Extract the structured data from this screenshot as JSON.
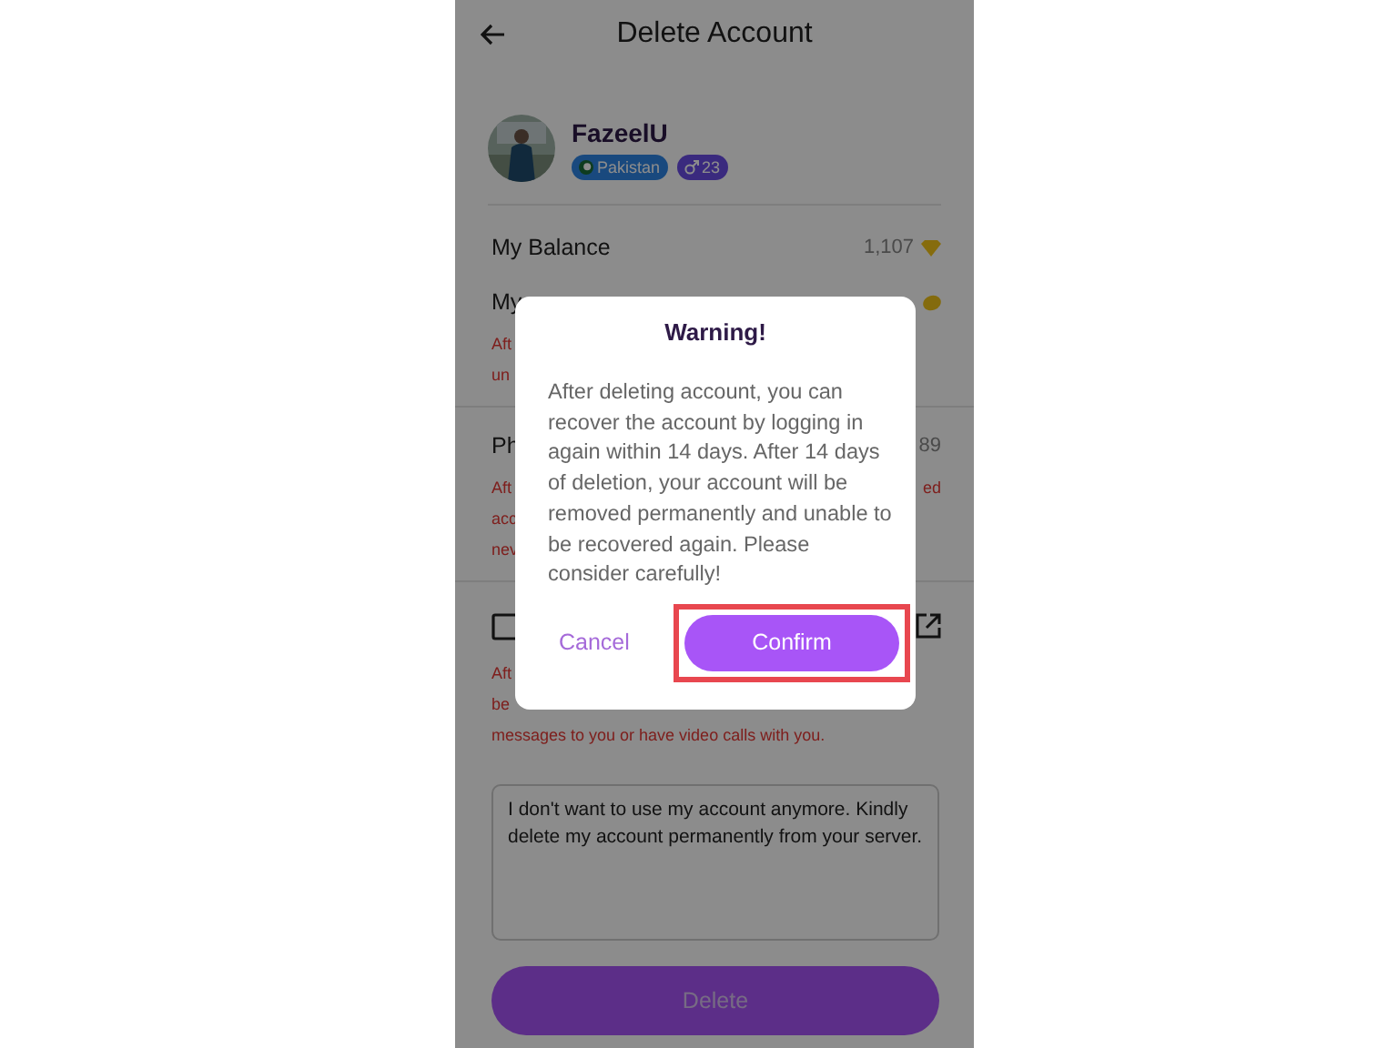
{
  "header": {
    "title": "Delete Account"
  },
  "profile": {
    "name": "FazeelU",
    "country": "Pakistan",
    "age": "23"
  },
  "rows": [
    {
      "kind": "balance",
      "label": "My Balance",
      "value": "1,107"
    },
    {
      "kind": "coins",
      "label": "My",
      "notice": [
        {
          "left": "Aft"
        },
        {
          "left": "un"
        }
      ]
    },
    {
      "kind": "text",
      "label": "Ph",
      "value": "89",
      "notice": [
        {
          "left": "Aft",
          "right": "ed"
        },
        {
          "left": "acc"
        },
        {
          "left": "nev"
        }
      ]
    },
    {
      "kind": "link",
      "notice": [
        {
          "left": "Aft"
        },
        {
          "left": "be"
        },
        {
          "left": "messages to you or have video calls with you."
        }
      ]
    }
  ],
  "reason": {
    "value": "I don't want to use my account anymore. Kindly delete my account permanently from your server."
  },
  "delete_button": {
    "label": "Delete"
  },
  "dialog": {
    "title": "Warning!",
    "message": "After deleting account, you can recover the account by logging in again within 14 days. After 14 days of deletion, your account will be removed permanently and unable to be recovered again. Please consider carefully!",
    "buttons": [
      {
        "kind": "text",
        "label": "Cancel",
        "highlighted": false
      },
      {
        "kind": "primary",
        "label": "Confirm",
        "highlighted": true
      }
    ]
  }
}
